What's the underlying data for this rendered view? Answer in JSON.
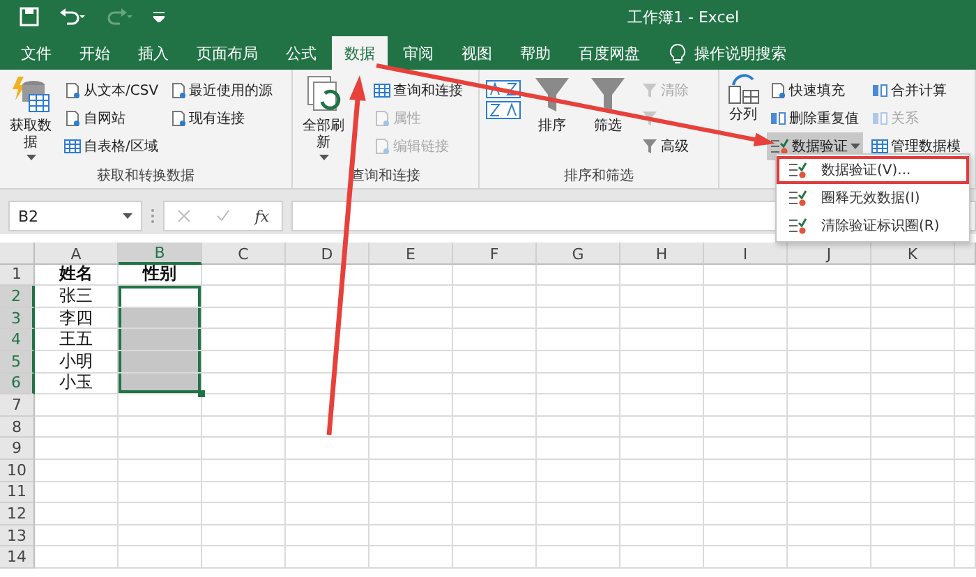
{
  "title_bar": {
    "title": "工作簿1  -  Excel"
  },
  "tabs": [
    {
      "label": "文件",
      "selected": false
    },
    {
      "label": "开始",
      "selected": false
    },
    {
      "label": "插入",
      "selected": false
    },
    {
      "label": "页面布局",
      "selected": false
    },
    {
      "label": "公式",
      "selected": false
    },
    {
      "label": "数据",
      "selected": true
    },
    {
      "label": "审阅",
      "selected": false
    },
    {
      "label": "视图",
      "selected": false
    },
    {
      "label": "帮助",
      "selected": false
    },
    {
      "label": "百度网盘",
      "selected": false
    }
  ],
  "tell_me": {
    "label": "操作说明搜索"
  },
  "ribbon_groups": [
    {
      "kind": "get",
      "label": "获取和转换数据",
      "items": [
        {
          "kind": "large",
          "label": "获取数据",
          "dropdown": true,
          "disabled": false
        },
        {
          "kind": "small",
          "label": "从文本/CSV",
          "disabled": false
        },
        {
          "kind": "small",
          "label": "自网站",
          "disabled": false
        },
        {
          "kind": "small",
          "label": "自表格/区域",
          "disabled": false
        },
        {
          "kind": "small",
          "label": "最近使用的源",
          "disabled": false
        },
        {
          "kind": "small",
          "label": "现有连接",
          "disabled": false
        }
      ]
    },
    {
      "kind": "query",
      "label": "查询和连接",
      "items": [
        {
          "kind": "large",
          "label": "全部刷新",
          "dropdown": true,
          "disabled": false
        },
        {
          "kind": "small",
          "label": "查询和连接",
          "disabled": false
        },
        {
          "kind": "small",
          "label": "属性",
          "disabled": true
        },
        {
          "kind": "small",
          "label": "编辑链接",
          "disabled": true
        }
      ]
    },
    {
      "kind": "sort",
      "label": "排序和筛选",
      "items": [
        {
          "kind": "large",
          "label": "排序",
          "disabled": false
        },
        {
          "kind": "large",
          "label": "筛选",
          "disabled": false
        },
        {
          "kind": "small",
          "label": "清除",
          "disabled": true
        },
        {
          "kind": "small",
          "disabled": true
        },
        {
          "kind": "small",
          "label": "高级",
          "disabled": false
        }
      ]
    },
    {
      "kind": "tools",
      "items": [
        {
          "kind": "large",
          "label": "分列",
          "disabled": false
        },
        {
          "kind": "small",
          "label": "快速填充",
          "disabled": false
        },
        {
          "kind": "small",
          "label": "删除重复值",
          "disabled": false
        },
        {
          "kind": "small",
          "label": "数据验证",
          "dropdown": true,
          "pressed": true,
          "disabled": false
        },
        {
          "kind": "small",
          "label": "合并计算",
          "disabled": false
        },
        {
          "kind": "small",
          "label": "关系",
          "disabled": true
        },
        {
          "kind": "small",
          "label": "管理数据模",
          "disabled": false
        }
      ]
    }
  ],
  "dropdown_menu": {
    "items": [
      {
        "label": "数据验证(V)...",
        "highlighted": true
      },
      {
        "label": "圈释无效数据(I)",
        "highlighted": false
      },
      {
        "label": "清除验证标识圈(R)",
        "highlighted": false
      }
    ]
  },
  "formula_bar": {
    "name_box": "B2",
    "function_label": "fx"
  },
  "sheet": {
    "columns": [
      "A",
      "B",
      "C",
      "D",
      "E",
      "F",
      "G",
      "H",
      "I",
      "J",
      "K"
    ],
    "rows": [
      {
        "header": "1",
        "cells": [
          {
            "text": "姓名",
            "bold": true,
            "selected": false
          },
          {
            "text": "性别",
            "bold": true,
            "selected": false
          }
        ]
      },
      {
        "header": "2",
        "cells": [
          {
            "text": "张三",
            "selected": false
          },
          {
            "selected": true,
            "active": true
          }
        ]
      },
      {
        "header": "3",
        "cells": [
          {
            "text": "李四",
            "selected": false
          },
          {
            "selected": true,
            "active": false
          }
        ]
      },
      {
        "header": "4",
        "cells": [
          {
            "text": "王五",
            "selected": false
          },
          {
            "selected": true,
            "active": false
          }
        ]
      },
      {
        "header": "5",
        "cells": [
          {
            "text": "小明",
            "selected": false
          },
          {
            "selected": true,
            "active": false
          }
        ]
      },
      {
        "header": "6",
        "cells": [
          {
            "text": "小玉",
            "selected": false
          },
          {
            "selected": true,
            "active": false
          }
        ]
      },
      {
        "header": "7",
        "cells": []
      },
      {
        "header": "8",
        "cells": []
      },
      {
        "header": "9",
        "cells": []
      },
      {
        "header": "10",
        "cells": []
      },
      {
        "header": "11",
        "cells": []
      },
      {
        "header": "12",
        "cells": []
      },
      {
        "header": "13",
        "cells": []
      },
      {
        "header": "14",
        "cells": []
      }
    ]
  }
}
